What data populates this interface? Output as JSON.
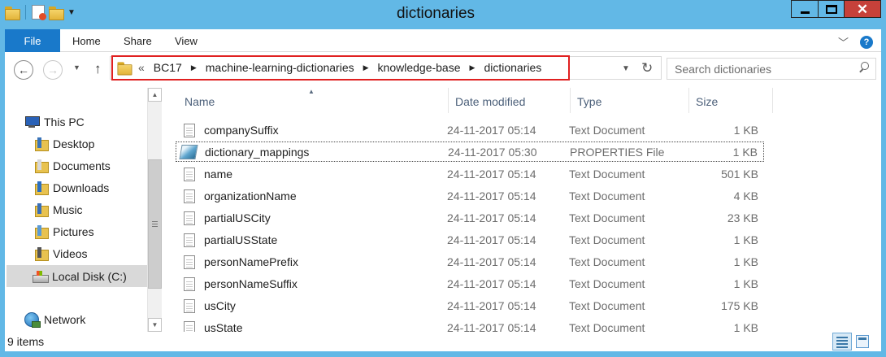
{
  "window": {
    "title": "dictionaries",
    "close_glyph": "✕",
    "quick_access": [
      "folder-icon",
      "properties-icon",
      "new-folder-icon",
      "customize-dropdown"
    ]
  },
  "ribbon": {
    "file_tab": "File",
    "tabs": [
      "Home",
      "Share",
      "View"
    ]
  },
  "nav": {
    "back_glyph": "←",
    "forward_glyph": "→",
    "up_glyph": "↑",
    "refresh_glyph": "↻",
    "overflow": "«",
    "breadcrumbs": [
      "BC17",
      "machine-learning-dictionaries",
      "knowledge-base",
      "dictionaries"
    ],
    "search_placeholder": "Search dictionaries"
  },
  "sidebar": {
    "items": [
      {
        "label": "This PC",
        "icon": "computer-icon"
      },
      {
        "label": "Desktop",
        "icon": "desktop-folder-icon"
      },
      {
        "label": "Documents",
        "icon": "documents-folder-icon"
      },
      {
        "label": "Downloads",
        "icon": "downloads-folder-icon"
      },
      {
        "label": "Music",
        "icon": "music-folder-icon"
      },
      {
        "label": "Pictures",
        "icon": "pictures-folder-icon"
      },
      {
        "label": "Videos",
        "icon": "videos-folder-icon"
      },
      {
        "label": "Local Disk (C:)",
        "icon": "local-disk-icon",
        "selected": true
      },
      {
        "label": "Network",
        "icon": "network-icon"
      }
    ]
  },
  "list": {
    "columns": [
      "Name",
      "Date modified",
      "Type",
      "Size"
    ],
    "rows": [
      {
        "name": "companySuffix",
        "date": "24-11-2017 05:14",
        "type": "Text Document",
        "size": "1 KB"
      },
      {
        "name": "dictionary_mappings",
        "date": "24-11-2017 05:30",
        "type": "PROPERTIES File",
        "size": "1 KB",
        "focused": true
      },
      {
        "name": "name",
        "date": "24-11-2017 05:14",
        "type": "Text Document",
        "size": "501 KB"
      },
      {
        "name": "organizationName",
        "date": "24-11-2017 05:14",
        "type": "Text Document",
        "size": "4 KB"
      },
      {
        "name": "partialUSCity",
        "date": "24-11-2017 05:14",
        "type": "Text Document",
        "size": "23 KB"
      },
      {
        "name": "partialUSState",
        "date": "24-11-2017 05:14",
        "type": "Text Document",
        "size": "1 KB"
      },
      {
        "name": "personNamePrefix",
        "date": "24-11-2017 05:14",
        "type": "Text Document",
        "size": "1 KB"
      },
      {
        "name": "personNameSuffix",
        "date": "24-11-2017 05:14",
        "type": "Text Document",
        "size": "1 KB"
      },
      {
        "name": "usCity",
        "date": "24-11-2017 05:14",
        "type": "Text Document",
        "size": "175 KB"
      },
      {
        "name": "usState",
        "date": "24-11-2017 05:14",
        "type": "Text Document",
        "size": "1 KB"
      }
    ]
  },
  "status": {
    "item_count": "9 items"
  },
  "colors": {
    "title_bar": "#62b8e6",
    "file_tab": "#1979ca",
    "close_button": "#c6413a",
    "address_highlight": "#e02020"
  }
}
